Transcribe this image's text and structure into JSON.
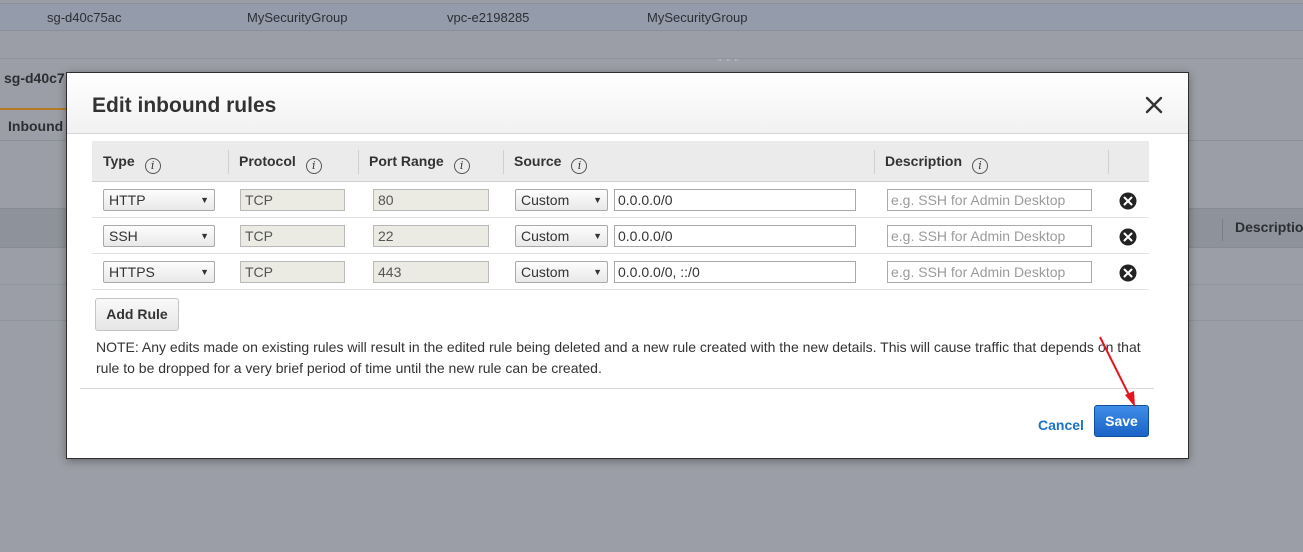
{
  "background": {
    "row": {
      "group_id": "sg-d40c75ac",
      "group_name": "MySecurityGroup",
      "vpc_id": "vpc-e2198285",
      "description": "MySecurityGroup"
    },
    "selected_id_truncated": "sg-d40c7",
    "resize_handle": "\" \" \"",
    "active_tab": "Inbound",
    "table_header_description": "Descriptio"
  },
  "modal": {
    "title": "Edit inbound rules",
    "close_icon": "close-icon",
    "columns": {
      "type": "Type",
      "protocol": "Protocol",
      "port_range": "Port Range",
      "source": "Source",
      "description": "Description"
    },
    "info_glyph": "i",
    "rules": [
      {
        "type": "HTTP",
        "protocol": "TCP",
        "port_range": "80",
        "source_type": "Custom",
        "source": "0.0.0.0/0",
        "description_placeholder": "e.g. SSH for Admin Desktop"
      },
      {
        "type": "SSH",
        "protocol": "TCP",
        "port_range": "22",
        "source_type": "Custom",
        "source": "0.0.0.0/0",
        "description_placeholder": "e.g. SSH for Admin Desktop"
      },
      {
        "type": "HTTPS",
        "protocol": "TCP",
        "port_range": "443",
        "source_type": "Custom",
        "source": "0.0.0.0/0, ::/0",
        "description_placeholder": "e.g. SSH for Admin Desktop"
      }
    ],
    "add_rule_label": "Add Rule",
    "note": "NOTE: Any edits made on existing rules will result in the edited rule being deleted and a new rule created with the new details. This will cause traffic that depends on that rule to be dropped for a very brief period of time until the new rule can be created.",
    "cancel_label": "Cancel",
    "save_label": "Save"
  },
  "colors": {
    "primary_button": "#1b63c6",
    "link": "#1a73c7",
    "annotation_arrow": "#e8141c",
    "overlay": "#9b9ea6"
  }
}
